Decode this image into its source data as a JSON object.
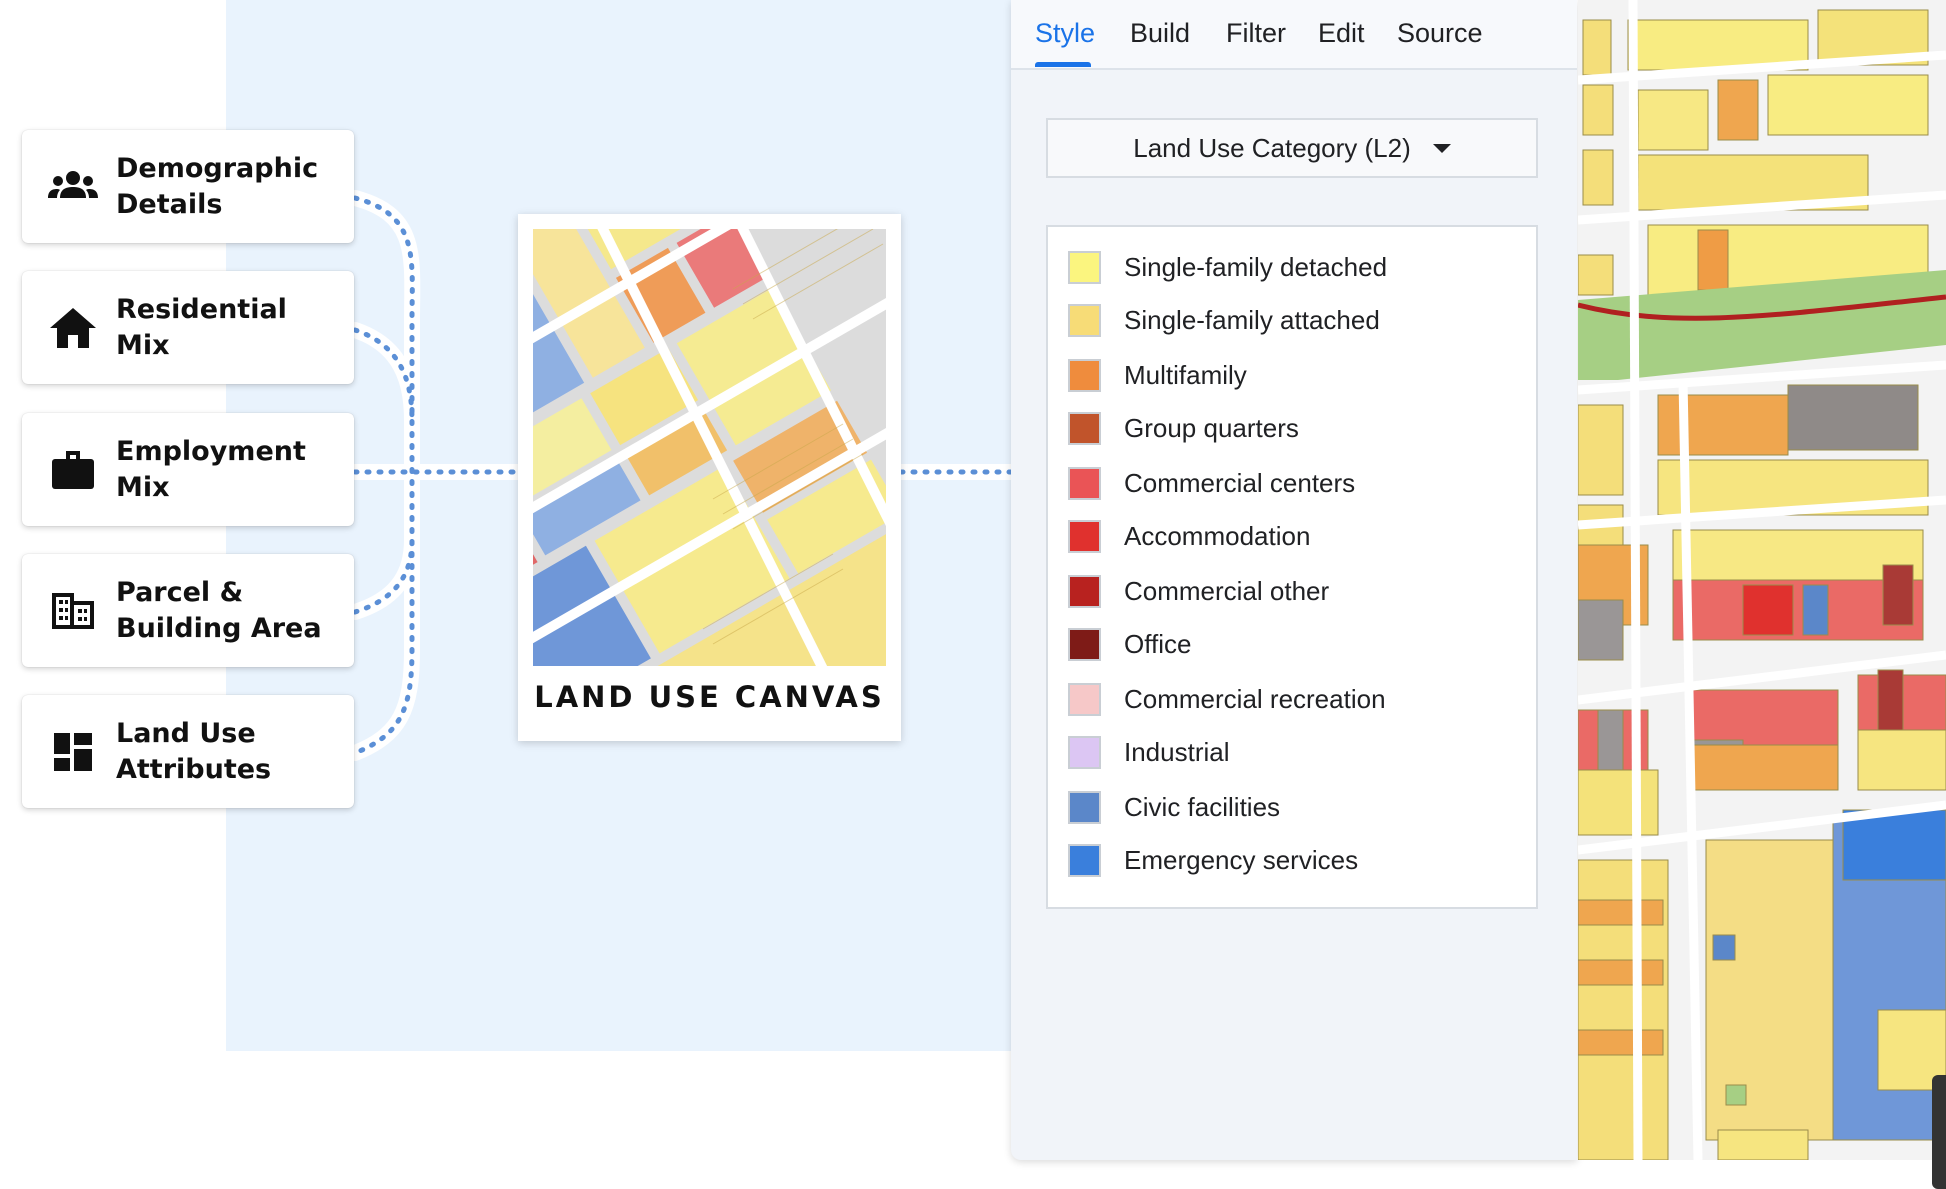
{
  "cards": [
    {
      "label_line1": "Demographic",
      "label_line2": "Details",
      "icon": "people-icon"
    },
    {
      "label_line1": "Residential",
      "label_line2": "Mix",
      "icon": "home-icon"
    },
    {
      "label_line1": "Employment",
      "label_line2": "Mix",
      "icon": "briefcase-icon"
    },
    {
      "label_line1": "Parcel &",
      "label_line2": "Building Area",
      "icon": "building-icon"
    },
    {
      "label_line1": "Land Use",
      "label_line2": "Attributes",
      "icon": "dashboard-icon"
    }
  ],
  "canvas": {
    "title": "LAND USE CANVAS"
  },
  "panel": {
    "tabs": [
      {
        "label": "Style",
        "active": true
      },
      {
        "label": "Build",
        "active": false
      },
      {
        "label": "Filter",
        "active": false
      },
      {
        "label": "Edit",
        "active": false
      },
      {
        "label": "Source",
        "active": false
      }
    ],
    "dropdown": {
      "value": "Land Use Category (L2)"
    },
    "legend": [
      {
        "label": "Single-family detached",
        "color": "#fbf57f"
      },
      {
        "label": "Single-family attached",
        "color": "#f7dc77"
      },
      {
        "label": "Multifamily",
        "color": "#ef8c3d"
      },
      {
        "label": "Group quarters",
        "color": "#c1542b"
      },
      {
        "label": "Commercial centers",
        "color": "#ea5456"
      },
      {
        "label": "Accommodation",
        "color": "#e0312e"
      },
      {
        "label": "Commercial other",
        "color": "#b8221f"
      },
      {
        "label": "Office",
        "color": "#7e1b17"
      },
      {
        "label": "Commercial recreation",
        "color": "#f6c8c8"
      },
      {
        "label": "Industrial",
        "color": "#dcc6f3"
      },
      {
        "label": "Civic facilities",
        "color": "#5b87c9"
      },
      {
        "label": "Emergency services",
        "color": "#3a7fdc"
      }
    ]
  },
  "colors": {
    "accent": "#1a73e8",
    "background_panel": "#e9f3fd",
    "connector": "#5b8fd6"
  }
}
